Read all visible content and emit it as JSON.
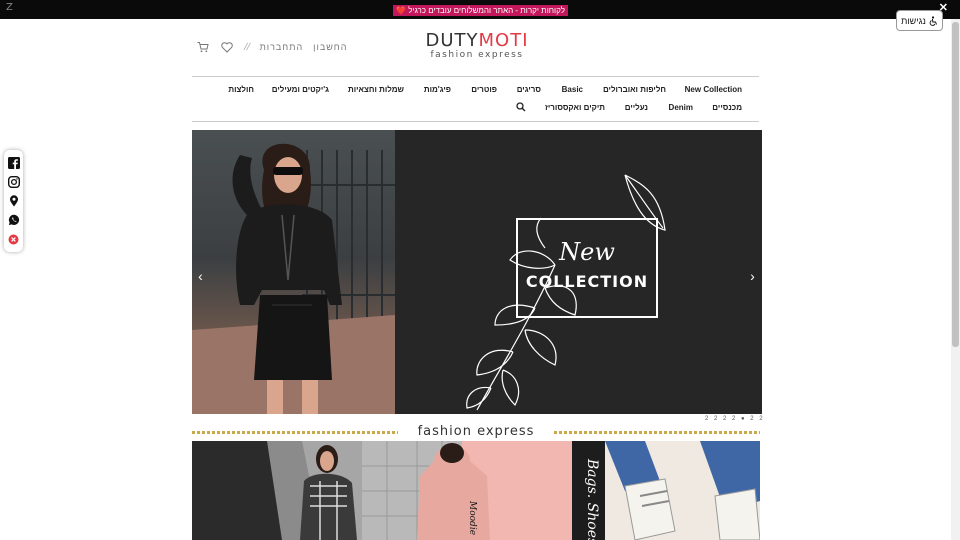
{
  "topbar": {
    "z_label": "Z",
    "promo_text": "לקוחות יקרות - האתר והמשלוחים עובדים כרגיל",
    "heart": "❤️",
    "close": "✕"
  },
  "accessibility": {
    "label": "נגישות"
  },
  "logo": {
    "part1": "DUTY",
    "part2": "MOTI",
    "tagline": "fashion express"
  },
  "header": {
    "account": "החשבון",
    "login": "התחברות",
    "separator": "//"
  },
  "nav": {
    "row1": [
      "New Collection",
      "חליפות ואוברולים",
      "Basic",
      "סריגים",
      "פוטרים",
      "פיג'מות",
      "שמלות וחצאיות",
      "ג'יקטים ומעילים",
      "חולצות"
    ],
    "row2": [
      "מכנסיים",
      "Denim",
      "נעליים",
      "תיקים ואקססוריז"
    ]
  },
  "hero": {
    "title_script": "New",
    "title_caps": "COLLECTION",
    "prev": "‹",
    "next": "›"
  },
  "slider_dots": "2 2 2 2 ● 2 2",
  "banner": {
    "text": "fashion express"
  },
  "cats": {
    "bags_shoes": "Bags. Shoes",
    "hoodie_text": "Moodie"
  },
  "colors": {
    "accent": "#e53946",
    "promo_bg": "#c2185b",
    "gold": "#c9a84c",
    "dark": "#262626"
  }
}
